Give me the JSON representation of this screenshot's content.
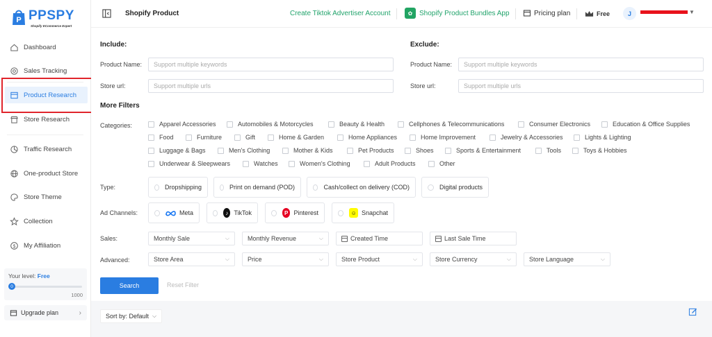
{
  "brand": {
    "name": "PPSPY",
    "tagline": "Shopify ECommerce Expert",
    "color": "#2a7de1"
  },
  "sidebar": {
    "items": [
      {
        "label": "Dashboard",
        "icon": "home-icon"
      },
      {
        "label": "Sales Tracking",
        "icon": "target-icon"
      },
      {
        "label": "Product Research",
        "icon": "product-box-icon",
        "active": true
      },
      {
        "label": "Store Research",
        "icon": "store-icon"
      },
      {
        "label": "Traffic Research",
        "icon": "traffic-icon"
      },
      {
        "label": "One-product Store",
        "icon": "globe-icon"
      },
      {
        "label": "Store Theme",
        "icon": "palette-icon"
      },
      {
        "label": "Collection",
        "icon": "star-icon"
      },
      {
        "label": "My Affiliation",
        "icon": "dollar-icon"
      }
    ],
    "level_label": "Your level:",
    "level_value": "Free",
    "level_current": "0",
    "level_max": "1000",
    "upgrade_label": "Upgrade plan"
  },
  "topbar": {
    "page_title": "Shopify Product",
    "link_tiktok": "Create Tiktok Advertiser Account",
    "bundles_app": "Shopify Product Bundles App",
    "pricing": "Pricing plan",
    "plan": "Free",
    "avatar_letter": "J"
  },
  "filters": {
    "include_title": "Include:",
    "exclude_title": "Exclude:",
    "product_name_label": "Product Name:",
    "store_url_label": "Store url:",
    "product_name_placeholder": "Support multiple keywords",
    "store_url_placeholder": "Support multiple urls",
    "more_filters_title": "More Filters",
    "categories_label": "Categories:",
    "categories": [
      "Apparel Accessories",
      "Automobiles & Motorcycles",
      "Beauty & Health",
      "Cellphones & Telecommunications",
      "Consumer Electronics",
      "Education & Office Supplies",
      "Food",
      "Furniture",
      "Gift",
      "Home & Garden",
      "Home Appliances",
      "Home Improvement",
      "Jewelry & Accessories",
      "Lights & Lighting",
      "Luggage & Bags",
      "Men's Clothing",
      "Mother & Kids",
      "Pet Products",
      "Shoes",
      "Sports & Entertainment",
      "Tools",
      "Toys & Hobbies",
      "Underwear & Sleepwears",
      "Watches",
      "Women's Clothing",
      "Adult Products",
      "Other"
    ],
    "type_label": "Type:",
    "types": [
      "Dropshipping",
      "Print on demand (POD)",
      "Cash/collect on delivery (COD)",
      "Digital products"
    ],
    "ad_channels_label": "Ad Channels:",
    "ad_channels": [
      {
        "label": "Meta",
        "icon": "meta-icon"
      },
      {
        "label": "TikTok",
        "icon": "tiktok-icon"
      },
      {
        "label": "Pinterest",
        "icon": "pinterest-icon"
      },
      {
        "label": "Snapchat",
        "icon": "snapchat-icon"
      }
    ],
    "sales_label": "Sales:",
    "sales": [
      "Monthly Sale",
      "Monthly Revenue",
      "Created Time",
      "Last Sale Time"
    ],
    "advanced_label": "Advanced:",
    "advanced": [
      "Store Area",
      "Price",
      "Store Product",
      "Store Currency",
      "Store Language"
    ],
    "search_button": "Search",
    "reset_button": "Reset Filter",
    "sort_by": "Sort by: Default"
  },
  "colors": {
    "accent": "#2a7de1",
    "green_link": "#21a36b",
    "highlight": "#e0242b"
  }
}
